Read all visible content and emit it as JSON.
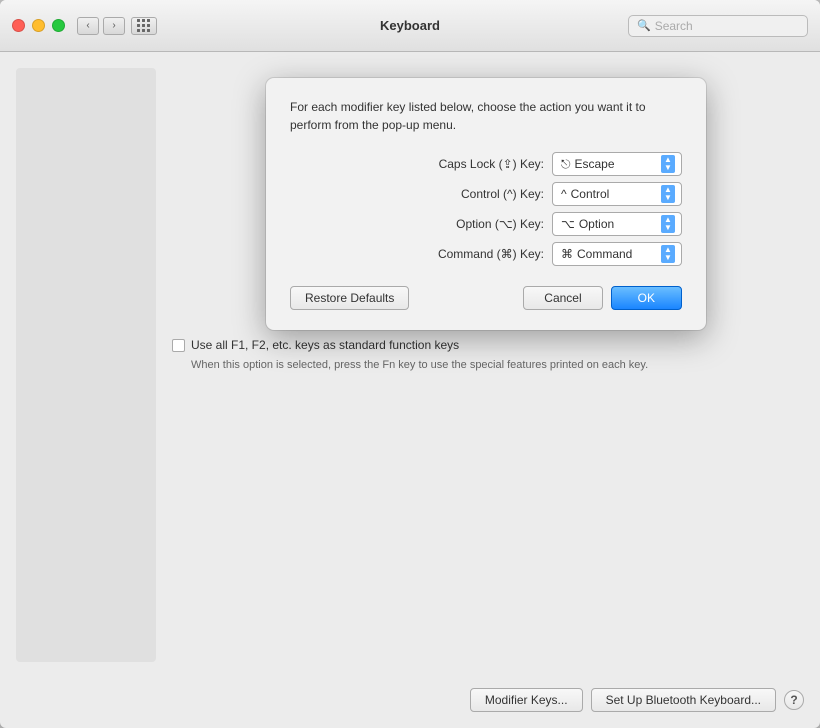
{
  "window": {
    "title": "Keyboard"
  },
  "titlebar": {
    "back_label": "‹",
    "forward_label": "›",
    "search_placeholder": "Search"
  },
  "modal": {
    "description": "For each modifier key listed below, choose the action you want it to perform from the pop-up menu.",
    "rows": [
      {
        "label": "Caps Lock (⇪) Key:",
        "icon": "⎋",
        "value": "Escape"
      },
      {
        "label": "Control (^) Key:",
        "icon": "^",
        "value": "Control"
      },
      {
        "label": "Option (⌥) Key:",
        "icon": "⌥",
        "value": "Option"
      },
      {
        "label": "Command (⌘) Key:",
        "icon": "⌘",
        "value": "Command"
      }
    ],
    "restore_defaults_label": "Restore Defaults",
    "cancel_label": "Cancel",
    "ok_label": "OK"
  },
  "checkbox": {
    "label": "Use all F1, F2, etc. keys as standard function keys",
    "description": "When this option is selected, press the Fn key to use the special features printed on each key."
  },
  "bottom_buttons": {
    "modifier_keys_label": "Modifier Keys...",
    "bluetooth_label": "Set Up Bluetooth Keyboard...",
    "help_label": "?"
  }
}
